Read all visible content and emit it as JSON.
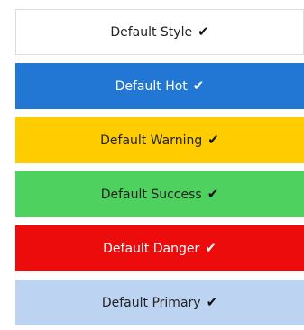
{
  "buttons": [
    {
      "label": "Default Style",
      "bg": "#ffffff",
      "fg": "#222222",
      "border": "#dddddd",
      "check": "✔",
      "check_color": "#111111"
    },
    {
      "label": "Default Hot",
      "bg": "#2277d5",
      "fg": "#ffffff",
      "border": "#2277d5",
      "check": "✔",
      "check_color": "#ffffff"
    },
    {
      "label": "Default Warning",
      "bg": "#ffcc00",
      "fg": "#222222",
      "border": "#ffcc00",
      "check": "✔",
      "check_color": "#111111"
    },
    {
      "label": "Default Success",
      "bg": "#4fd15f",
      "fg": "#222222",
      "border": "#4fd15f",
      "check": "✔",
      "check_color": "#111111"
    },
    {
      "label": "Default Danger",
      "bg": "#ec0c0c",
      "fg": "#ffffff",
      "border": "#ec0c0c",
      "check": "✔",
      "check_color": "#ffffff"
    },
    {
      "label": "Default Primary",
      "bg": "#bcd4f2",
      "fg": "#222222",
      "border": "#bcd4f2",
      "check": "✔",
      "check_color": "#111111"
    }
  ]
}
